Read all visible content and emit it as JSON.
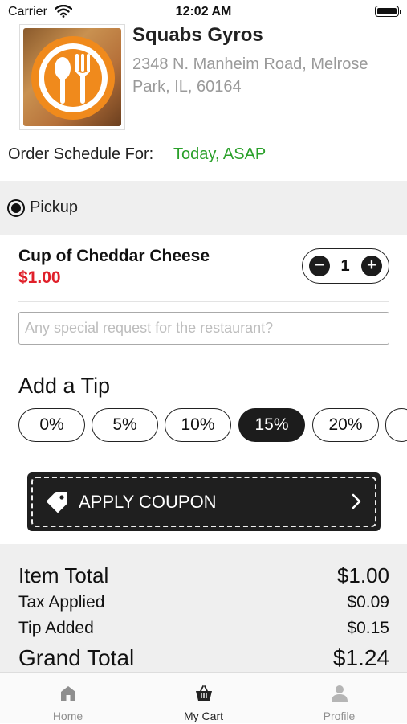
{
  "status_bar": {
    "carrier": "Carrier",
    "time": "12:02 AM"
  },
  "restaurant": {
    "name": "Squabs Gyros",
    "address": "2348 N. Manheim Road, Melrose Park, IL, 60164"
  },
  "schedule": {
    "label": "Order Schedule For:",
    "value": "Today, ASAP"
  },
  "order_type": {
    "selected": "Pickup"
  },
  "cart_item": {
    "name": "Cup of Cheddar Cheese",
    "price": "$1.00",
    "quantity": "1"
  },
  "special_request": {
    "placeholder": "Any special request for the restaurant?",
    "value": ""
  },
  "tip": {
    "title": "Add a Tip",
    "options": [
      "0%",
      "5%",
      "10%",
      "15%",
      "20%"
    ],
    "selected": "15%"
  },
  "coupon": {
    "label": "APPLY COUPON"
  },
  "summary": {
    "item_total_label": "Item Total",
    "item_total": "$1.00",
    "tax_label": "Tax Applied",
    "tax": "$0.09",
    "tip_label": "Tip Added",
    "tip": "$0.15",
    "grand_total_label": "Grand Total",
    "grand_total": "$1.24"
  },
  "tabs": [
    {
      "label": "Home",
      "icon": "home-icon"
    },
    {
      "label": "My Cart",
      "icon": "basket-icon"
    },
    {
      "label": "Profile",
      "icon": "person-icon"
    }
  ],
  "active_tab": "My Cart",
  "colors": {
    "accent_green": "#2aa02a",
    "price_red": "#e0202a",
    "dark": "#1c1c1c",
    "logo_orange": "#f08a1c"
  }
}
